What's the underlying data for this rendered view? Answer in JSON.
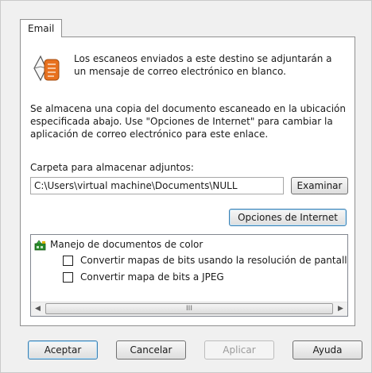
{
  "tabs": [
    {
      "label": "Email"
    }
  ],
  "intro_text": "Los escaneos enviados a este destino se adjuntarán a un mensaje de correo electrónico en blanco.",
  "description_text": "Se almacena una copia del documento escaneado en la ubicación especificada abajo. Use \"Opciones de Internet\" para cambiar la aplicación de correo electrónico para este enlace.",
  "folder": {
    "label": "Carpeta para almacenar adjuntos:",
    "value": "C:\\Users\\virtual machine\\Documents\\NULL",
    "browse_label": "Examinar"
  },
  "internet_options_label": "Opciones de Internet",
  "tree": {
    "root_label": "Manejo de documentos de color",
    "options": [
      {
        "label": "Convertir mapas de bits usando la resolución de pantalla",
        "checked": false
      },
      {
        "label": "Convertir mapa de bits a JPEG",
        "checked": false
      }
    ]
  },
  "scrollbar_thumb_grip": "III",
  "buttons": {
    "ok": "Aceptar",
    "cancel": "Cancelar",
    "apply": "Aplicar",
    "help": "Ayuda"
  },
  "colors": {
    "icon_orange": "#e8711f",
    "default_button_border": "#3c7fb1"
  },
  "icons": {
    "header": "email-destination-icon",
    "tree_root": "color-documents-icon"
  }
}
